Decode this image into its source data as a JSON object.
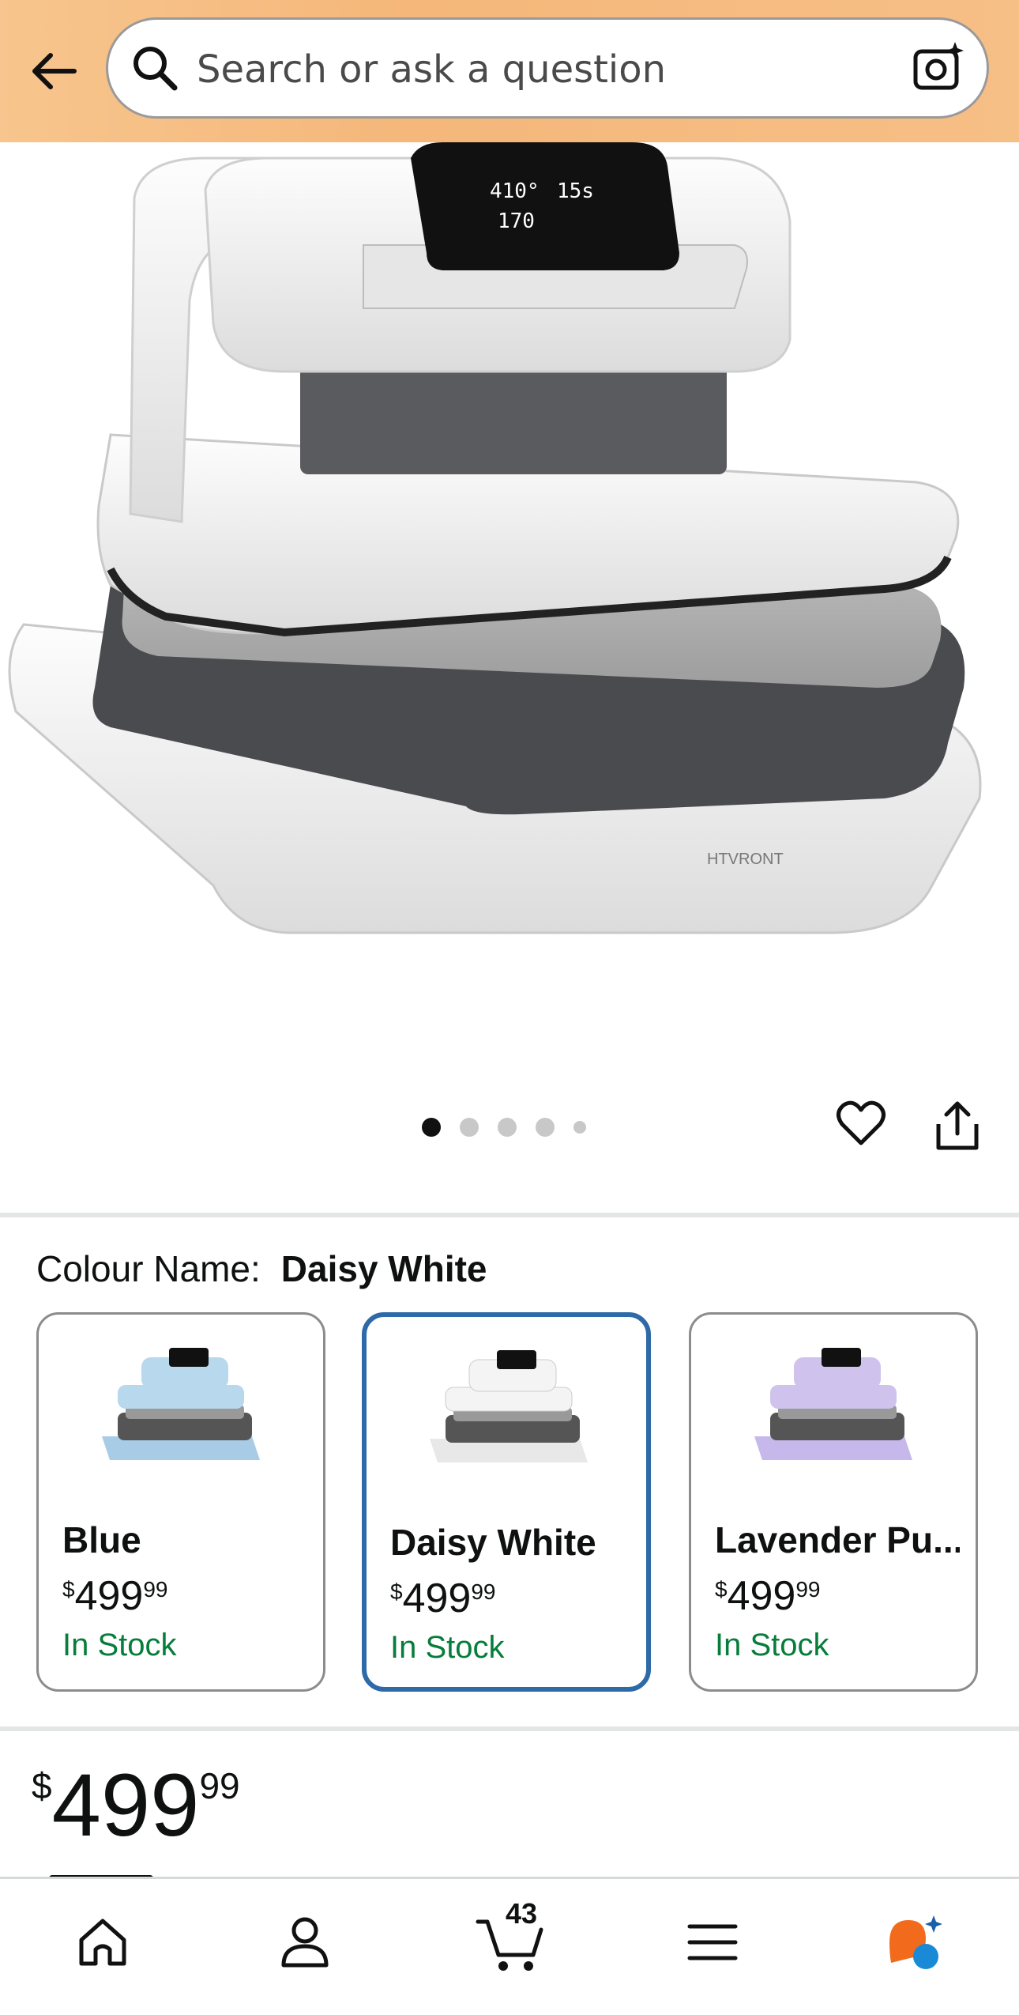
{
  "search": {
    "placeholder": "Search or ask a question"
  },
  "gallery": {
    "image_count": 5,
    "active_index": 0
  },
  "variation": {
    "label": "Colour Name:",
    "selected": "Daisy White",
    "options": [
      {
        "name": "Blue",
        "price_symbol": "$",
        "price_whole": "499",
        "price_fraction": "99",
        "availability": "In Stock",
        "accent": "#b8d8ee"
      },
      {
        "name": "Daisy White",
        "price_symbol": "$",
        "price_whole": "499",
        "price_fraction": "99",
        "availability": "In Stock",
        "accent": "#f2f2f2"
      },
      {
        "name": "Lavender Pu...",
        "price_symbol": "$",
        "price_whole": "499",
        "price_fraction": "99",
        "availability": "In Stock",
        "accent": "#cfc3ee"
      }
    ]
  },
  "price": {
    "symbol": "$",
    "whole": "499",
    "fraction": "99"
  },
  "nav": {
    "cart_count": "43"
  },
  "colors": {
    "topbar": "#f6bd82",
    "in_stock": "#067d3a",
    "selected_border": "#2e6aa8"
  }
}
